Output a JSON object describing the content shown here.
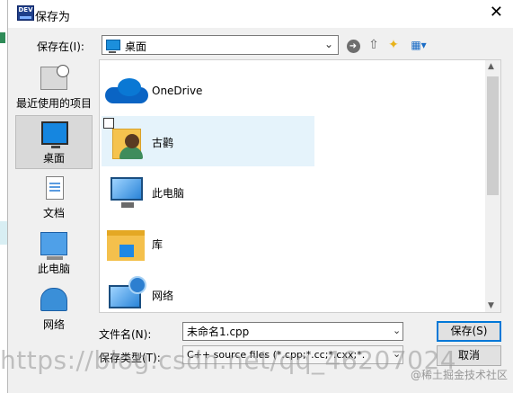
{
  "dialog": {
    "title": "保存为",
    "app_icon_text": "DEV",
    "close_glyph": "✕"
  },
  "save_in": {
    "label": "保存在(I):",
    "value": "桌面",
    "chevron": "⌄"
  },
  "toolbar": {
    "back_glyph": "➜",
    "up_glyph": "⇧",
    "new_folder_glyph": "✦",
    "views_glyph": "▦▾"
  },
  "places": [
    {
      "label": "最近使用的项目",
      "icon": "recent-items-icon"
    },
    {
      "label": "桌面",
      "icon": "desktop-icon",
      "active": true
    },
    {
      "label": "文档",
      "icon": "documents-icon"
    },
    {
      "label": "此电脑",
      "icon": "this-pc-icon"
    },
    {
      "label": "网络",
      "icon": "network-icon"
    }
  ],
  "files": [
    {
      "label": "OneDrive",
      "icon": "onedrive-icon"
    },
    {
      "label": "古鹳",
      "icon": "user-folder-icon",
      "selected": true
    },
    {
      "label": "此电脑",
      "icon": "this-pc-icon"
    },
    {
      "label": "库",
      "icon": "libraries-icon"
    },
    {
      "label": "网络",
      "icon": "network-icon"
    }
  ],
  "scrollbar": {
    "up": "▲",
    "down": "▼"
  },
  "file_name": {
    "label": "文件名(N):",
    "value": "未命名1.cpp"
  },
  "file_type": {
    "label": "保存类型(T):",
    "value": "C++ source files (*.cpp;*.cc;*.cxx;*."
  },
  "buttons": {
    "save": "保存(S)",
    "cancel": "取消"
  },
  "watermark": {
    "url": "https://blog.csdn.net/qq_46207024",
    "brand": "@稀土掘金技术社区"
  }
}
